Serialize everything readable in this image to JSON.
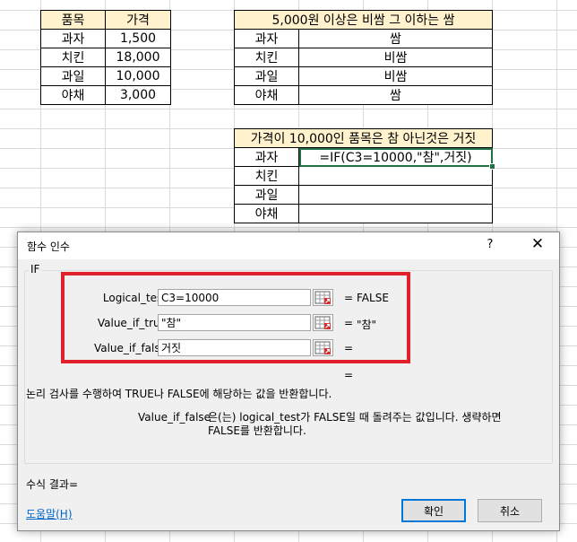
{
  "sheet": {
    "table1": {
      "headers": [
        "품목",
        "가격"
      ],
      "rows": [
        [
          "과자",
          "1,500"
        ],
        [
          "치킨",
          "18,000"
        ],
        [
          "과일",
          "10,000"
        ],
        [
          "야채",
          "3,000"
        ]
      ]
    },
    "table2": {
      "title": "5,000원 이상은 비쌈 그 이하는 쌈",
      "rows": [
        [
          "과자",
          "쌈"
        ],
        [
          "치킨",
          "비쌈"
        ],
        [
          "과일",
          "비쌈"
        ],
        [
          "야채",
          "쌈"
        ]
      ]
    },
    "table3": {
      "title": "가격이 10,000인 품목은 참 아닌것은 거짓",
      "rows": [
        [
          "과자",
          "=IF(C3=10000,\"참\",거짓)"
        ],
        [
          "치킨",
          ""
        ],
        [
          "과일",
          ""
        ],
        [
          "야채",
          ""
        ]
      ]
    },
    "header_color": "#fff2cc",
    "active_cell_color": "#217346"
  },
  "dialog": {
    "title": "함수 인수",
    "help_symbol": "?",
    "close_symbol": "✕",
    "function_name": "IF",
    "args": [
      {
        "label": "Logical_test",
        "value": "C3=10000",
        "result": "FALSE"
      },
      {
        "label": "Value_if_true",
        "value": "\"참\"",
        "result": "\"참\""
      },
      {
        "label": "Value_if_false",
        "value": "거짓",
        "result": ""
      }
    ],
    "equals": "=",
    "overall_equals": "=",
    "description": "논리 검사를 수행하여 TRUE나 FALSE에 해당하는 값을 반환합니다.",
    "arg_desc_name": "Value_if_false",
    "arg_desc_text": "은(는) logical_test가 FALSE일 때 돌려주는 값입니다. 생략하면 FALSE를 반환합니다.",
    "formula_result": "수식 결과=",
    "help_link": "도움말(H)",
    "ok": "확인",
    "cancel": "취소",
    "highlight_color": "#e0202a",
    "ref_icon": "range-select-icon"
  }
}
